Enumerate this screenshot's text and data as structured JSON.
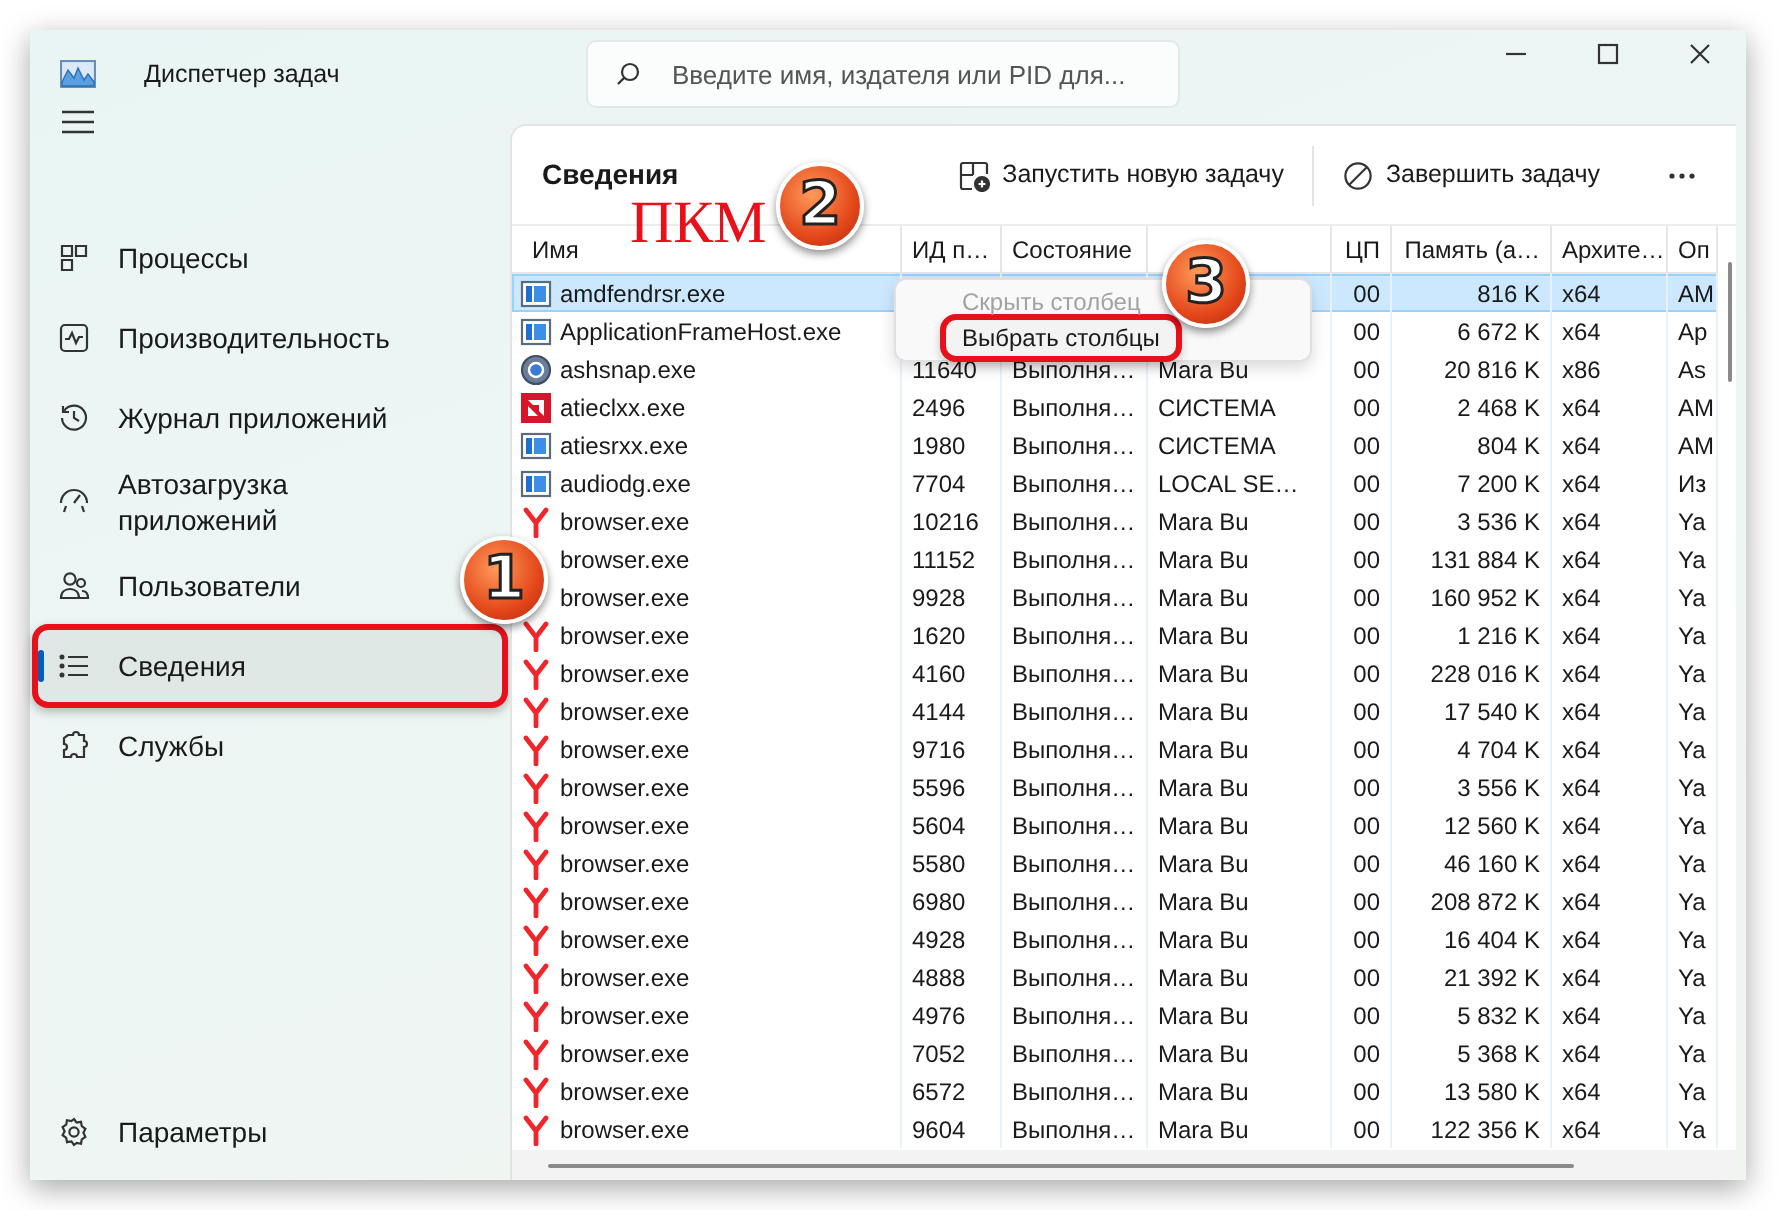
{
  "window": {
    "title": "Диспетчер задач"
  },
  "search": {
    "placeholder": "Введите имя, издателя или PID для..."
  },
  "sidebar": {
    "items": [
      {
        "label": "Процессы",
        "selected": false,
        "highlighted": false
      },
      {
        "label": "Производительность",
        "selected": false,
        "highlighted": false
      },
      {
        "label": "Журнал приложений",
        "selected": false,
        "highlighted": false
      },
      {
        "label": "Автозагрузка приложений",
        "selected": false,
        "highlighted": false
      },
      {
        "label": "Пользователи",
        "selected": false,
        "highlighted": false
      },
      {
        "label": "Сведения",
        "selected": true,
        "highlighted": true
      },
      {
        "label": "Службы",
        "selected": false,
        "highlighted": false
      }
    ],
    "footer": {
      "label": "Параметры"
    }
  },
  "page": {
    "title": "Сведения",
    "actions": [
      "Запустить новую задачу",
      "Завершить задачу"
    ]
  },
  "table": {
    "columns": [
      "Имя",
      "ИД п…",
      "Состояние",
      null,
      "ЦП",
      "Память (а…",
      "Архите…",
      "Оп"
    ],
    "rows": [
      {
        "kind": "app",
        "name": "amdfendrsr.exe",
        "cpu": "00",
        "memory": "816 K",
        "arch": "x64",
        "column_8": "AM",
        "selected": true
      },
      {
        "kind": "app",
        "name": "ApplicationFrameHost.exe",
        "cpu": "00",
        "memory": "6 672 K",
        "arch": "x64",
        "column_8": "Ap",
        "selected": false
      },
      {
        "kind": "snap",
        "name": "ashsnap.exe",
        "pid": "11640",
        "status": "Выполня…",
        "user": "Mara Bu",
        "cpu": "00",
        "memory": "20 816 K",
        "arch": "x86",
        "column_8": "As",
        "selected": false
      },
      {
        "kind": "amd",
        "name": "atieclxx.exe",
        "pid": "2496",
        "status": "Выполня…",
        "user": "СИСТЕМА",
        "cpu": "00",
        "memory": "2 468 K",
        "arch": "x64",
        "column_8": "AM",
        "selected": false
      },
      {
        "kind": "app",
        "name": "atiesrxx.exe",
        "pid": "1980",
        "status": "Выполня…",
        "user": "СИСТЕМА",
        "cpu": "00",
        "memory": "804 K",
        "arch": "x64",
        "column_8": "AM",
        "selected": false
      },
      {
        "kind": "app",
        "name": "audiodg.exe",
        "pid": "7704",
        "status": "Выполня…",
        "user": "LOCAL SE…",
        "cpu": "00",
        "memory": "7 200 K",
        "arch": "x64",
        "column_8": "Из",
        "selected": false
      },
      {
        "kind": "browser",
        "name": "browser.exe",
        "pid": "10216",
        "status": "Выполня…",
        "user": "Mara Bu",
        "cpu": "00",
        "memory": "3 536 K",
        "arch": "x64",
        "column_8": "Ya",
        "selected": false
      },
      {
        "name": "browser.exe",
        "pid": "11152",
        "status": "Выполня…",
        "user": "Mara Bu",
        "cpu": "00",
        "memory": "131 884 K",
        "arch": "x64",
        "column_8": "Ya",
        "selected": false
      },
      {
        "name": "browser.exe",
        "pid": "9928",
        "status": "Выполня…",
        "user": "Mara Bu",
        "cpu": "00",
        "memory": "160 952 K",
        "arch": "x64",
        "column_8": "Ya",
        "selected": false
      },
      {
        "kind": "browser",
        "name": "browser.exe",
        "pid": "1620",
        "status": "Выполня…",
        "user": "Mara Bu",
        "cpu": "00",
        "memory": "1 216 K",
        "arch": "x64",
        "column_8": "Ya",
        "selected": false
      },
      {
        "kind": "browser",
        "name": "browser.exe",
        "pid": "4160",
        "status": "Выполня…",
        "user": "Mara Bu",
        "cpu": "00",
        "memory": "228 016 K",
        "arch": "x64",
        "column_8": "Ya",
        "selected": false
      },
      {
        "kind": "browser",
        "name": "browser.exe",
        "pid": "4144",
        "status": "Выполня…",
        "user": "Mara Bu",
        "cpu": "00",
        "memory": "17 540 K",
        "arch": "x64",
        "column_8": "Ya",
        "selected": false
      },
      {
        "kind": "browser",
        "name": "browser.exe",
        "pid": "9716",
        "status": "Выполня…",
        "user": "Mara Bu",
        "cpu": "00",
        "memory": "4 704 K",
        "arch": "x64",
        "column_8": "Ya",
        "selected": false
      },
      {
        "kind": "browser",
        "name": "browser.exe",
        "pid": "5596",
        "status": "Выполня…",
        "user": "Mara Bu",
        "cpu": "00",
        "memory": "3 556 K",
        "arch": "x64",
        "column_8": "Ya",
        "selected": false
      },
      {
        "kind": "browser",
        "name": "browser.exe",
        "pid": "5604",
        "status": "Выполня…",
        "user": "Mara Bu",
        "cpu": "00",
        "memory": "12 560 K",
        "arch": "x64",
        "column_8": "Ya",
        "selected": false
      },
      {
        "kind": "browser",
        "name": "browser.exe",
        "pid": "5580",
        "status": "Выполня…",
        "user": "Mara Bu",
        "cpu": "00",
        "memory": "46 160 K",
        "arch": "x64",
        "column_8": "Ya",
        "selected": false
      },
      {
        "kind": "browser",
        "name": "browser.exe",
        "pid": "6980",
        "status": "Выполня…",
        "user": "Mara Bu",
        "cpu": "00",
        "memory": "208 872 K",
        "arch": "x64",
        "column_8": "Ya",
        "selected": false
      },
      {
        "kind": "browser",
        "name": "browser.exe",
        "pid": "4928",
        "status": "Выполня…",
        "user": "Mara Bu",
        "cpu": "00",
        "memory": "16 404 K",
        "arch": "x64",
        "column_8": "Ya",
        "selected": false
      },
      {
        "kind": "browser",
        "name": "browser.exe",
        "pid": "4888",
        "status": "Выполня…",
        "user": "Mara Bu",
        "cpu": "00",
        "memory": "21 392 K",
        "arch": "x64",
        "column_8": "Ya",
        "selected": false
      },
      {
        "kind": "browser",
        "name": "browser.exe",
        "pid": "4976",
        "status": "Выполня…",
        "user": "Mara Bu",
        "cpu": "00",
        "memory": "5 832 K",
        "arch": "x64",
        "column_8": "Ya",
        "selected": false
      },
      {
        "kind": "browser",
        "name": "browser.exe",
        "pid": "7052",
        "status": "Выполня…",
        "user": "Mara Bu",
        "cpu": "00",
        "memory": "5 368 K",
        "arch": "x64",
        "column_8": "Ya",
        "selected": false
      },
      {
        "kind": "browser",
        "name": "browser.exe",
        "pid": "6572",
        "status": "Выполня…",
        "user": "Mara Bu",
        "cpu": "00",
        "memory": "13 580 K",
        "arch": "x64",
        "column_8": "Ya",
        "selected": false
      },
      {
        "kind": "browser",
        "name": "browser.exe",
        "pid": "9604",
        "status": "Выполня…",
        "user": "Mara Bu",
        "cpu": "00",
        "memory": "122 356 K",
        "arch": "x64",
        "column_8": "Ya",
        "selected": false
      }
    ]
  },
  "context_menu": {
    "items": [
      {
        "label": "Скрыть столбец",
        "disabled": true,
        "highlighted": false
      },
      {
        "label": "Выбрать столбцы",
        "disabled": false,
        "highlighted": true
      }
    ]
  },
  "annotations": {
    "caption": "ПКМ",
    "badges": [
      "1",
      "2",
      "3"
    ]
  }
}
